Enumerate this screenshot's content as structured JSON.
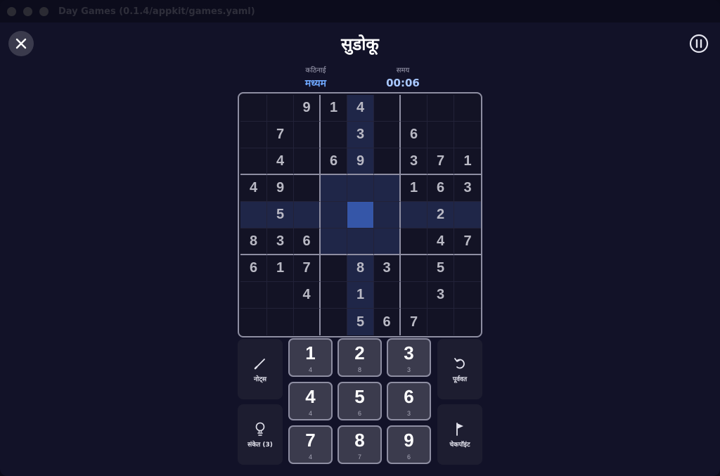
{
  "window": {
    "title": "Day Games (0.1.4/appkit/games.yaml)"
  },
  "game": {
    "title": "सुडोकू"
  },
  "stats": {
    "difficulty_label": "कठिनाई",
    "difficulty_value": "मध्यम",
    "time_label": "समय",
    "time_value": "00:06"
  },
  "board": {
    "selected": {
      "row": 4,
      "col": 4
    },
    "rows": [
      [
        "",
        "",
        "9",
        "1",
        "4",
        "",
        "",
        "",
        ""
      ],
      [
        "",
        "7",
        "",
        "",
        "3",
        "",
        "6",
        "",
        ""
      ],
      [
        "",
        "4",
        "",
        "6",
        "9",
        "",
        "3",
        "7",
        "1"
      ],
      [
        "4",
        "9",
        "",
        "",
        "",
        "",
        "1",
        "6",
        "3"
      ],
      [
        "",
        "5",
        "",
        "",
        "",
        "",
        "",
        "2",
        ""
      ],
      [
        "8",
        "3",
        "6",
        "",
        "",
        "",
        "",
        "4",
        "7"
      ],
      [
        "6",
        "1",
        "7",
        "",
        "8",
        "3",
        "",
        "5",
        ""
      ],
      [
        "",
        "",
        "4",
        "",
        "1",
        "",
        "",
        "3",
        ""
      ],
      [
        "",
        "",
        "",
        "",
        "5",
        "6",
        "7",
        "",
        ""
      ]
    ]
  },
  "numpad": [
    {
      "digit": "1",
      "remaining": "4"
    },
    {
      "digit": "2",
      "remaining": "8"
    },
    {
      "digit": "3",
      "remaining": "3"
    },
    {
      "digit": "4",
      "remaining": "4"
    },
    {
      "digit": "5",
      "remaining": "6"
    },
    {
      "digit": "6",
      "remaining": "3"
    },
    {
      "digit": "7",
      "remaining": "4"
    },
    {
      "digit": "8",
      "remaining": "7"
    },
    {
      "digit": "9",
      "remaining": "6"
    }
  ],
  "actions": {
    "notes_label": "नोट्स",
    "hint_label": "संकेत (3)",
    "undo_label": "पूर्ववत",
    "checkpoint_label": "चेकपॉइंट"
  },
  "icons": {
    "close": "close-icon",
    "pause": "pause-icon",
    "notes": "pencil-icon",
    "hint": "lightbulb-icon",
    "undo": "undo-icon",
    "checkpoint": "flag-icon"
  },
  "colors": {
    "background": "#121228",
    "accent": "#6fa8ff",
    "selected_cell": "#3556a8",
    "highlight": "#1f2648"
  }
}
